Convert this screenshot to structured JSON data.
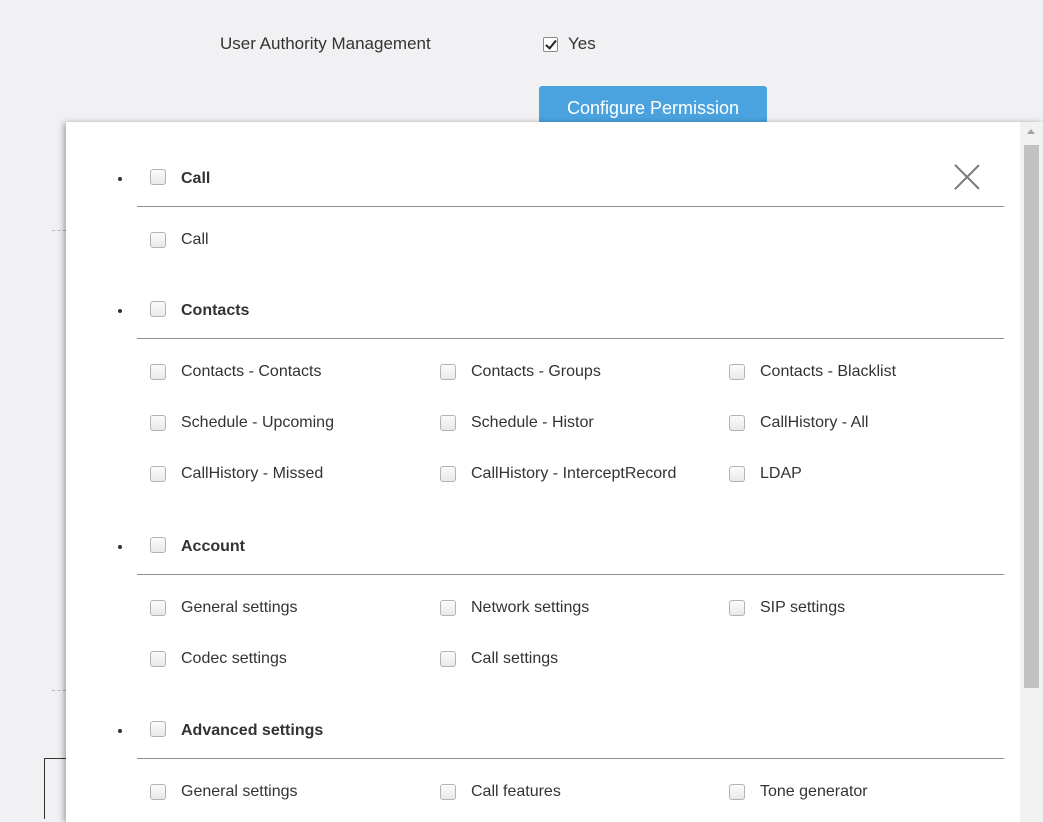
{
  "background": {
    "field_label": "User Authority Management",
    "checkbox_label": "Yes",
    "checkbox_checked": true,
    "configure_button": "Configure Permission",
    "button_color": "#4aa3df"
  },
  "modal": {
    "close_icon": "close-icon",
    "sections": [
      {
        "title": "Call",
        "items": [
          "Call"
        ]
      },
      {
        "title": "Contacts",
        "items": [
          "Contacts - Contacts",
          "Contacts - Groups",
          "Contacts - Blacklist",
          "Schedule - Upcoming",
          "Schedule - Histor",
          "CallHistory - All",
          "CallHistory - Missed",
          "CallHistory - InterceptRecord",
          "LDAP"
        ]
      },
      {
        "title": "Account",
        "items": [
          "General settings",
          "Network settings",
          "SIP settings",
          "Codec settings",
          "Call settings"
        ]
      },
      {
        "title": "Advanced settings",
        "items": [
          "General settings",
          "Call features",
          "Tone generator"
        ]
      }
    ]
  }
}
